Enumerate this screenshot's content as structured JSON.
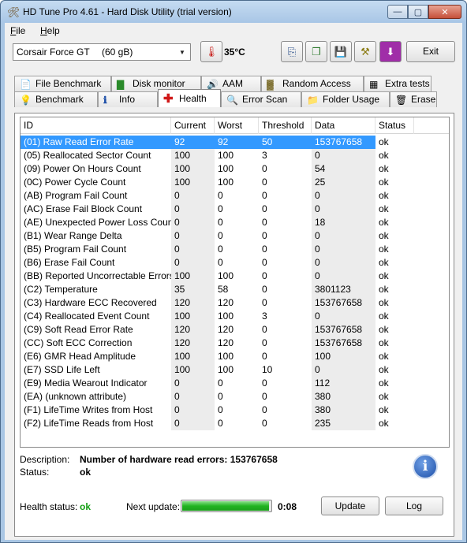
{
  "window": {
    "title": "HD Tune Pro 4.61 - Hard Disk Utility (trial version)"
  },
  "menu": [
    {
      "label": "File",
      "accel": "F",
      "rest": "ile"
    },
    {
      "label": "Help",
      "accel": "H",
      "rest": "elp"
    }
  ],
  "toolbar": {
    "drive_name": "Corsair Force GT",
    "drive_size": "(60 gB)",
    "temperature": "35°C",
    "exit_label": "Exit"
  },
  "tabs_top": [
    "File Benchmark",
    "Disk monitor",
    "AAM",
    "Random Access",
    "Extra tests"
  ],
  "tabs_bottom": [
    "Benchmark",
    "Info",
    "Health",
    "Error Scan",
    "Folder Usage",
    "Erase"
  ],
  "active_tab": "Health",
  "table": {
    "columns": [
      "ID",
      "Current",
      "Worst",
      "Threshold",
      "Data",
      "Status"
    ],
    "rows": [
      [
        "(01) Raw Read Error Rate",
        "92",
        "92",
        "50",
        "153767658",
        "ok"
      ],
      [
        "(05) Reallocated Sector Count",
        "100",
        "100",
        "3",
        "0",
        "ok"
      ],
      [
        "(09) Power On Hours Count",
        "100",
        "100",
        "0",
        "54",
        "ok"
      ],
      [
        "(0C) Power Cycle Count",
        "100",
        "100",
        "0",
        "25",
        "ok"
      ],
      [
        "(AB) Program Fail Count",
        "0",
        "0",
        "0",
        "0",
        "ok"
      ],
      [
        "(AC) Erase Fail Block Count",
        "0",
        "0",
        "0",
        "0",
        "ok"
      ],
      [
        "(AE) Unexpected Power Loss Count",
        "0",
        "0",
        "0",
        "18",
        "ok"
      ],
      [
        "(B1) Wear Range Delta",
        "0",
        "0",
        "0",
        "0",
        "ok"
      ],
      [
        "(B5) Program Fail Count",
        "0",
        "0",
        "0",
        "0",
        "ok"
      ],
      [
        "(B6) Erase Fail Count",
        "0",
        "0",
        "0",
        "0",
        "ok"
      ],
      [
        "(BB) Reported Uncorrectable Errors",
        "100",
        "100",
        "0",
        "0",
        "ok"
      ],
      [
        "(C2) Temperature",
        "35",
        "58",
        "0",
        "3801123",
        "ok"
      ],
      [
        "(C3) Hardware ECC Recovered",
        "120",
        "120",
        "0",
        "153767658",
        "ok"
      ],
      [
        "(C4) Reallocated Event Count",
        "100",
        "100",
        "3",
        "0",
        "ok"
      ],
      [
        "(C9) Soft Read Error Rate",
        "120",
        "120",
        "0",
        "153767658",
        "ok"
      ],
      [
        "(CC) Soft ECC Correction",
        "120",
        "120",
        "0",
        "153767658",
        "ok"
      ],
      [
        "(E6) GMR Head Amplitude",
        "100",
        "100",
        "0",
        "100",
        "ok"
      ],
      [
        "(E7) SSD Life Left",
        "100",
        "100",
        "10",
        "0",
        "ok"
      ],
      [
        "(E9) Media Wearout Indicator",
        "0",
        "0",
        "0",
        "112",
        "ok"
      ],
      [
        "(EA) (unknown attribute)",
        "0",
        "0",
        "0",
        "380",
        "ok"
      ],
      [
        "(F1) LifeTime Writes from Host",
        "0",
        "0",
        "0",
        "380",
        "ok"
      ],
      [
        "(F2) LifeTime Reads from Host",
        "0",
        "0",
        "0",
        "235",
        "ok"
      ]
    ],
    "selected_row": 0
  },
  "description": {
    "desc_label": "Description:",
    "desc_value": "Number of hardware read errors: 153767658",
    "status_label": "Status:",
    "status_value": "ok"
  },
  "footer": {
    "health_label": "Health status:",
    "health_value": "ok",
    "next_update_label": "Next update:",
    "progress_fraction": 0.98,
    "countdown": "0:08",
    "update_label": "Update",
    "log_label": "Log"
  },
  "colors": {
    "selection": "#3399ff",
    "ok_green": "#14a014",
    "progress": "#22b422"
  }
}
